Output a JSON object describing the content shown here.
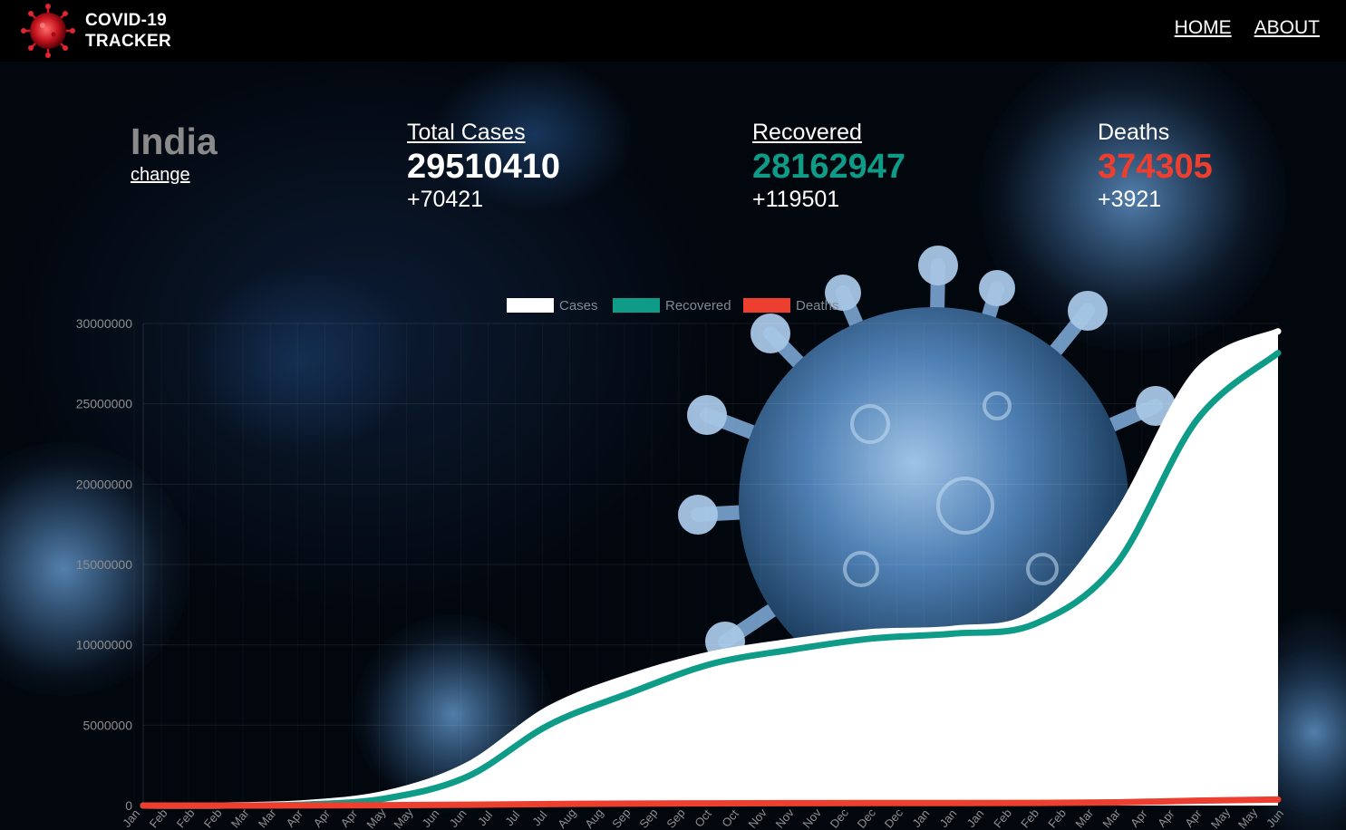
{
  "nav": {
    "brand_line1": "COVID-19",
    "brand_line2": "TRACKER",
    "links": [
      "HOME",
      "ABOUT"
    ]
  },
  "country": {
    "name": "India",
    "change_label": "change"
  },
  "stats": {
    "total": {
      "label": "Total Cases",
      "value": "29510410",
      "delta": "+70421",
      "color": "#ffffff"
    },
    "recovered": {
      "label": "Recovered",
      "value": "28162947",
      "delta": "+119501",
      "color": "#0e9b87"
    },
    "deaths": {
      "label": "Deaths",
      "value": "374305",
      "delta": "+3921",
      "color": "#ec3f2f"
    }
  },
  "chart_data": {
    "type": "line",
    "legend": [
      {
        "name": "Cases",
        "color": "#ffffff"
      },
      {
        "name": "Recovered",
        "color": "#0e9b87"
      },
      {
        "name": "Deaths",
        "color": "#ec3f2f"
      }
    ],
    "legend_position": "top",
    "ylim": [
      0,
      30000000
    ],
    "y_ticks": [
      "30000000",
      "25000000",
      "20000000",
      "15000000",
      "10000000",
      "5000000",
      "0"
    ],
    "x_ticks": [
      "Jan",
      "Feb",
      "Feb",
      "Feb",
      "Mar",
      "Mar",
      "Apr",
      "Apr",
      "Apr",
      "May",
      "May",
      "Jun",
      "Jun",
      "Jul",
      "Jul",
      "Jul",
      "Aug",
      "Aug",
      "Sep",
      "Sep",
      "Sep",
      "Oct",
      "Oct",
      "Nov",
      "Nov",
      "Nov",
      "Dec",
      "Dec",
      "Dec",
      "Jan",
      "Jan",
      "Jan",
      "Feb",
      "Feb",
      "Feb",
      "Mar",
      "Mar",
      "Apr",
      "Apr",
      "Apr",
      "May",
      "May",
      "Jun"
    ],
    "grid": true,
    "x": [
      "Jan 2020",
      "Mar 2020",
      "May 2020",
      "Jul 2020",
      "Aug 2020",
      "Sep 2020",
      "Oct 2020",
      "Nov 2020",
      "Dec 2020",
      "Jan 2021",
      "Feb 2021",
      "Mar 2021",
      "Apr 2021",
      "May 2021",
      "Jun 2021"
    ],
    "series": [
      {
        "name": "Cases",
        "values": [
          0,
          1000,
          150000,
          750000,
          2500000,
          6000000,
          8000000,
          9400000,
          10200000,
          10800000,
          11000000,
          12000000,
          18000000,
          27000000,
          29510410
        ]
      },
      {
        "name": "Recovered",
        "values": [
          0,
          100,
          60000,
          450000,
          1800000,
          5000000,
          7000000,
          8800000,
          9700000,
          10400000,
          10700000,
          11300000,
          15000000,
          24000000,
          28162947
        ]
      },
      {
        "name": "Deaths",
        "values": [
          0,
          10,
          4000,
          20000,
          50000,
          95000,
          122000,
          137000,
          145000,
          152000,
          155000,
          162000,
          200000,
          300000,
          374305
        ]
      }
    ]
  }
}
